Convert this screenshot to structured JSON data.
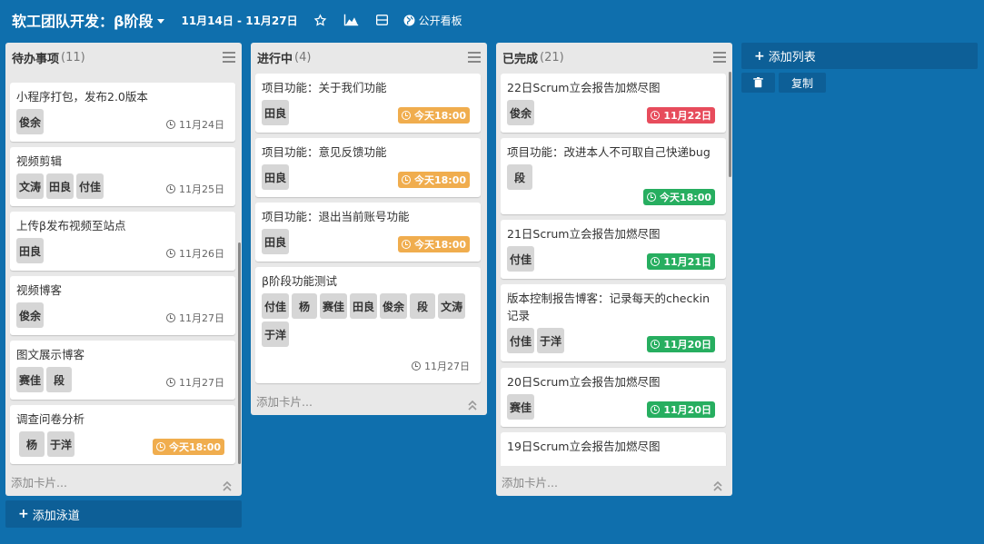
{
  "header": {
    "title": "软工团队开发：β阶段",
    "date_range": "11月14日 - 11月27日",
    "public_label": "公开看板"
  },
  "lists": [
    {
      "title": "待办事项",
      "count": "(11)",
      "add_card": "添加卡片...",
      "cards": [
        {
          "title": "小程序打包，发布2.0版本",
          "members": [
            "俊余"
          ],
          "due": "11月24日"
        },
        {
          "title": "视频剪辑",
          "members": [
            "文涛",
            "田良",
            "付佳"
          ],
          "due": "11月25日"
        },
        {
          "title": "上传β发布视频至站点",
          "members": [
            "田良"
          ],
          "due": "11月26日"
        },
        {
          "title": "视频博客",
          "members": [
            "俊余"
          ],
          "due": "11月27日"
        },
        {
          "title": "图文展示博客",
          "members": [
            "赛佳",
            "段"
          ],
          "due": "11月27日"
        },
        {
          "title": "调查问卷分析",
          "members": [
            "杨",
            "于洋"
          ],
          "due": "今天18:00"
        }
      ]
    },
    {
      "title": "进行中",
      "count": "(4)",
      "add_card": "添加卡片...",
      "cards": [
        {
          "title": "项目功能：关于我们功能",
          "members": [
            "田良"
          ],
          "due": "今天18:00"
        },
        {
          "title": "项目功能：意见反馈功能",
          "members": [
            "田良"
          ],
          "due": "今天18:00"
        },
        {
          "title": "项目功能：退出当前账号功能",
          "members": [
            "田良"
          ],
          "due": "今天18:00"
        },
        {
          "title": "β阶段功能测试",
          "members": [
            "付佳",
            "杨",
            "赛佳",
            "田良",
            "俊余",
            "段",
            "文涛",
            "于洋"
          ],
          "due": "11月27日"
        }
      ]
    },
    {
      "title": "已完成",
      "count": "(21)",
      "add_card": "添加卡片...",
      "cards": [
        {
          "title": "22日Scrum立会报告加燃尽图",
          "members": [
            "俊余"
          ],
          "due": "11月22日"
        },
        {
          "title": "项目功能：改进本人不可取自己快递bug",
          "members": [
            "段"
          ],
          "due": "今天18:00"
        },
        {
          "title": "21日Scrum立会报告加燃尽图",
          "members": [
            "付佳"
          ],
          "due": "11月21日"
        },
        {
          "title": "版本控制报告博客：记录每天的checkin记录",
          "members": [
            "付佳",
            "于洋"
          ],
          "due": "11月20日"
        },
        {
          "title": "20日Scrum立会报告加燃尽图",
          "members": [
            "赛佳"
          ],
          "due": "11月20日"
        },
        {
          "title": "19日Scrum立会报告加燃尽图",
          "members": [],
          "due": ""
        }
      ]
    }
  ],
  "add_lane_label": "添加泳道",
  "add_list_label": "添加列表",
  "copy_label": "复制",
  "colors": {
    "background": "#0f6fad",
    "due_soon": "#f0ad4e",
    "overdue": "#e74c5c",
    "complete": "#27ae60"
  }
}
